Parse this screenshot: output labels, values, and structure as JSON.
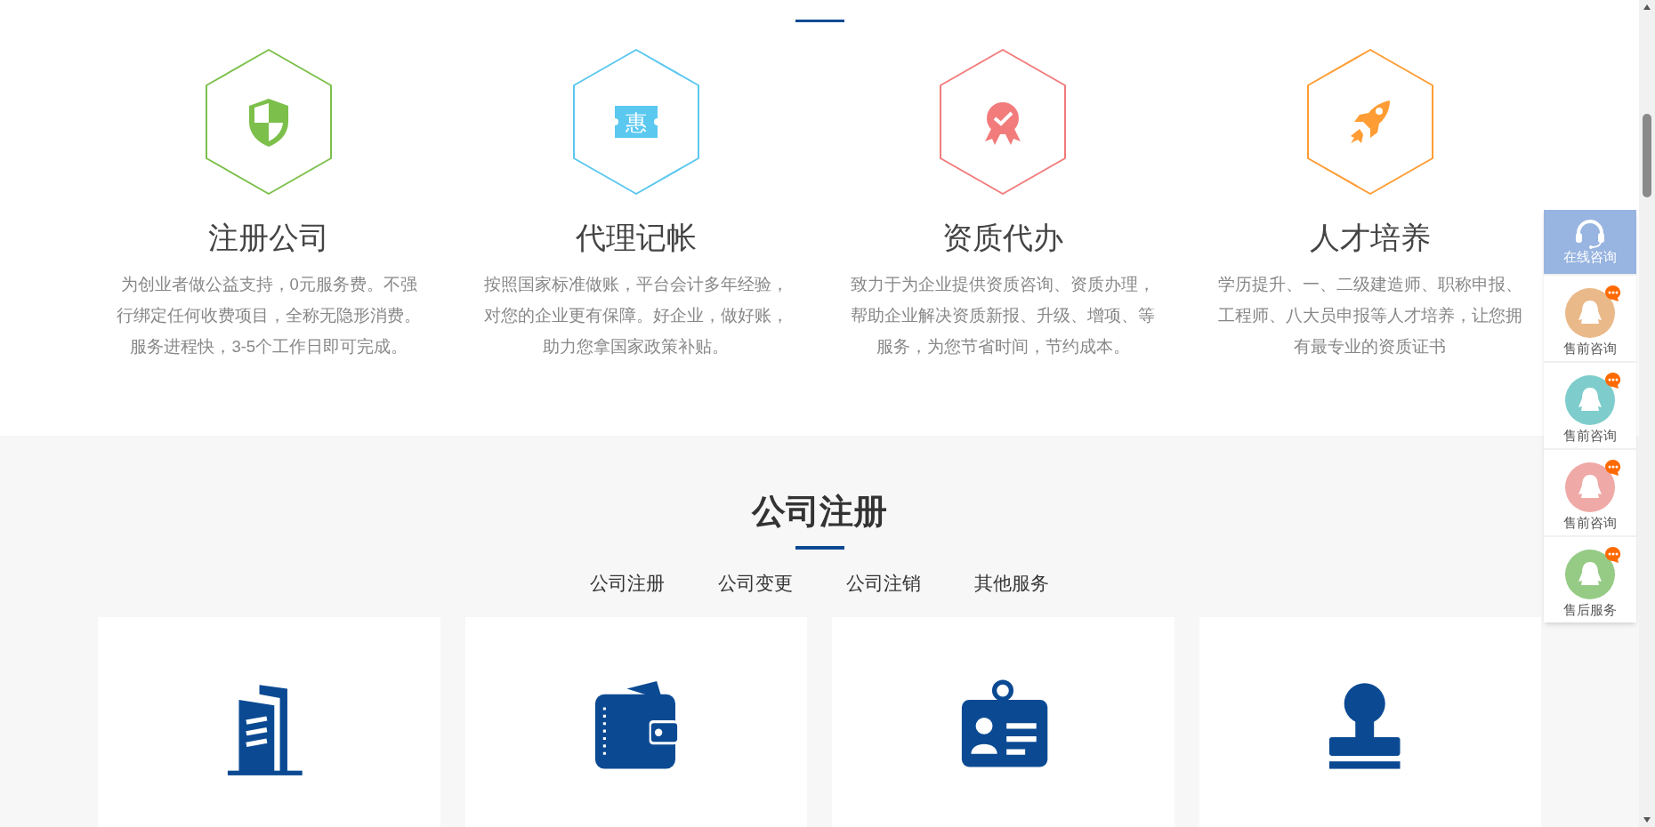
{
  "features": [
    {
      "kind": "shield",
      "color": "#7cc04b",
      "title": "注册公司",
      "description": "为创业者做公益支持，0元服务费。不强行绑定任何收费项目，全称无隐形消费。服务进程快，3-5个工作日即可完成。"
    },
    {
      "kind": "ticket",
      "color": "#5bc8f0",
      "icon_text": "惠",
      "title": "代理记帐",
      "description": "按照国家标准做账，平台会计多年经验，对您的企业更有保障。好企业，做好账，助力您拿国家政策补贴。"
    },
    {
      "kind": "award",
      "color": "#f27b7b",
      "title": "资质代办",
      "description": "致力于为企业提供资质咨询、资质办理，帮助企业解决资质新报、升级、增项、等服务，为您节省时间，节约成本。"
    },
    {
      "kind": "rocket",
      "color": "#ff9c33",
      "title": "人才培养",
      "description": "学历提升、一、二级建造师、职称申报、工程师、八大员申报等人才培养，让您拥有最专业的资质证书"
    }
  ],
  "section": {
    "title": "公司注册",
    "tabs": [
      "公司注册",
      "公司变更",
      "公司注销",
      "其他服务"
    ],
    "cards": [
      {
        "kind": "building"
      },
      {
        "kind": "wallet"
      },
      {
        "kind": "id-card"
      },
      {
        "kind": "stamp"
      }
    ]
  },
  "sidebar": [
    {
      "kind": "online",
      "label": "在线咨询"
    },
    {
      "kind": "qq",
      "color": "#eab98a",
      "label": "售前咨询"
    },
    {
      "kind": "qq",
      "color": "#7ecdcc",
      "label": "售前咨询"
    },
    {
      "kind": "qq",
      "color": "#efa9a6",
      "label": "售前咨询"
    },
    {
      "kind": "qq",
      "color": "#96cb85",
      "label": "售后服务"
    }
  ]
}
